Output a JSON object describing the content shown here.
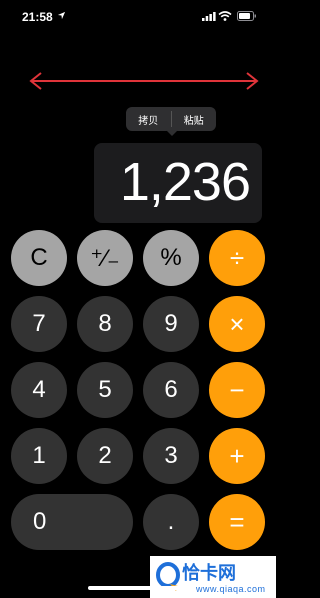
{
  "status_bar": {
    "time": "21:58"
  },
  "clipboard_menu": {
    "copy_label": "拷贝",
    "paste_label": "粘贴"
  },
  "display": {
    "value": "1,236"
  },
  "keypad": {
    "rows": [
      [
        {
          "label": "C",
          "style": "light",
          "name": "clear-key"
        },
        {
          "label": "⁺⁄₋",
          "style": "light",
          "name": "sign-toggle-key"
        },
        {
          "label": "%",
          "style": "light",
          "name": "percent-key"
        },
        {
          "label": "÷",
          "style": "orange",
          "name": "divide-key"
        }
      ],
      [
        {
          "label": "7",
          "style": "dark",
          "name": "digit-7-key"
        },
        {
          "label": "8",
          "style": "dark",
          "name": "digit-8-key"
        },
        {
          "label": "9",
          "style": "dark",
          "name": "digit-9-key"
        },
        {
          "label": "×",
          "style": "orange",
          "name": "multiply-key"
        }
      ],
      [
        {
          "label": "4",
          "style": "dark",
          "name": "digit-4-key"
        },
        {
          "label": "5",
          "style": "dark",
          "name": "digit-5-key"
        },
        {
          "label": "6",
          "style": "dark",
          "name": "digit-6-key"
        },
        {
          "label": "−",
          "style": "orange",
          "name": "subtract-key"
        }
      ],
      [
        {
          "label": "1",
          "style": "dark",
          "name": "digit-1-key"
        },
        {
          "label": "2",
          "style": "dark",
          "name": "digit-2-key"
        },
        {
          "label": "3",
          "style": "dark",
          "name": "digit-3-key"
        },
        {
          "label": "+",
          "style": "orange",
          "name": "add-key"
        }
      ],
      [
        {
          "label": "0",
          "style": "dark",
          "name": "digit-0-key",
          "wide": true
        },
        {
          "label": ".",
          "style": "dark",
          "name": "decimal-key"
        },
        {
          "label": "=",
          "style": "orange",
          "name": "equals-key"
        }
      ]
    ]
  },
  "watermark": {
    "title": "恰卡网",
    "url": "www.qiaqa.com"
  },
  "colors": {
    "orange": "#ff9f0a",
    "light_gray": "#a5a5a5",
    "dark_gray": "#333333",
    "annotation_red": "#e0343a"
  }
}
